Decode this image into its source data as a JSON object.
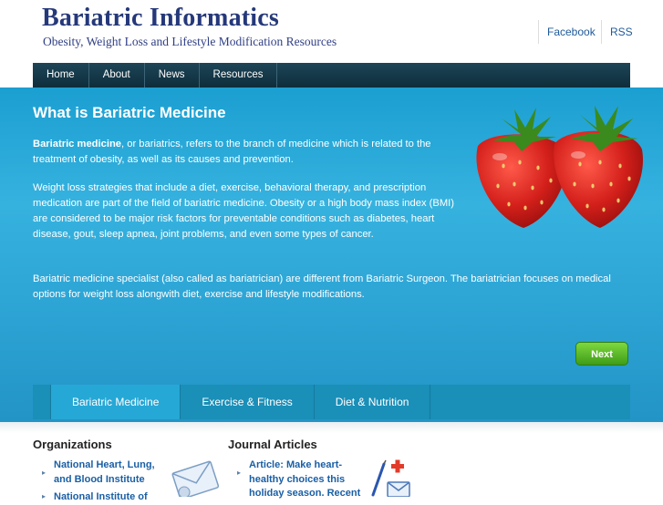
{
  "header": {
    "title": "Bariatric Informatics",
    "tagline": "Obesity, Weight Loss and Lifestyle Modification Resources",
    "social": [
      "Facebook",
      "RSS"
    ]
  },
  "nav": {
    "items": [
      "Home",
      "About",
      "News",
      "Resources"
    ]
  },
  "hero": {
    "title": "What is Bariatric Medicine",
    "p1_strong": "Bariatric medicine",
    "p1_rest": ", or bariatrics, refers to the branch of medicine which is related to the treatment of obesity, as well as its causes and prevention.",
    "p2": "Weight loss strategies that include a diet, exercise, behavioral therapy, and prescription medication are part of the field of bariatric medicine. Obesity or a high body mass index (BMI) are considered to be major risk factors for preventable conditions such as diabetes, heart disease, gout, sleep apnea, joint problems, and even some types of cancer.",
    "p3": "Bariatric medicine specialist (also called as bariatrician) are different from Bariatric Surgeon. The bariatrician focuses on medical options for weight loss alongwith diet, exercise and lifestyle modifications.",
    "next_label": "Next",
    "image": "strawberries-image"
  },
  "tabs": {
    "items": [
      "Bariatric Medicine",
      "Exercise & Fitness",
      "Diet & Nutrition"
    ],
    "active_index": 0
  },
  "organizations": {
    "heading": "Organizations",
    "items": [
      "National Heart, Lung, and Blood Institute",
      "National Institute of"
    ]
  },
  "articles": {
    "heading": "Journal Articles",
    "items": [
      "Article: Make heart-healthy choices this holiday season. Recent"
    ]
  },
  "icons": {
    "organizations": "envelope-icon",
    "articles": "medical-icon"
  },
  "colors": {
    "brand_title": "#25387a",
    "banner": "#2ba2d3",
    "nav": "#163a4b",
    "next_button": "#5cbd2a",
    "link": "#1a5fa5"
  }
}
